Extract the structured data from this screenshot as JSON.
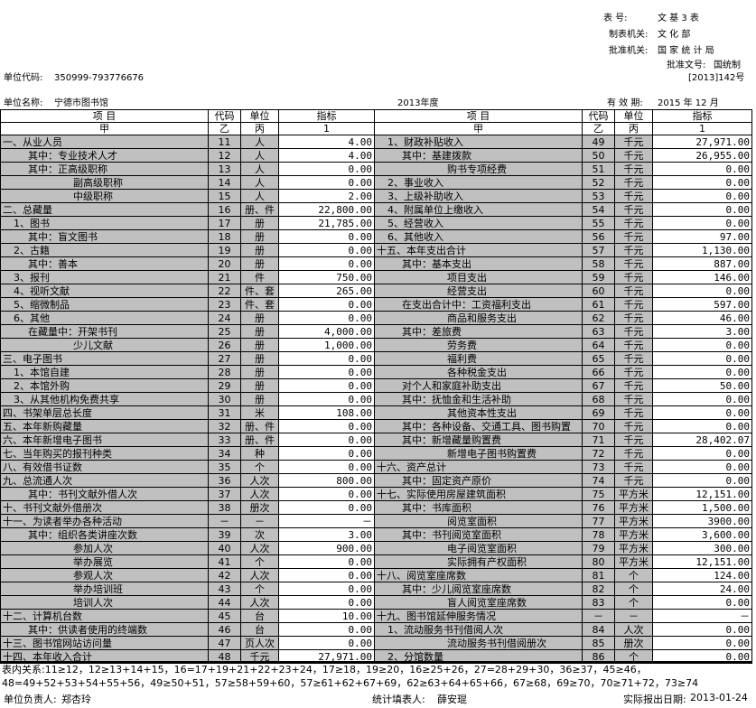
{
  "header": {
    "form_no_label": "表 号:",
    "form_no_value": "文 基 3 表",
    "org_label": "制表机关:",
    "org_value": "文 化 部",
    "approve_label": "批准机关:",
    "approve_value": "国 家 统 计 局",
    "approve_doc_label": "批准文号:",
    "approve_doc_value": "国统制",
    "approve_doc_no": "[2013]142号",
    "unit_code_label": "单位代码:",
    "unit_code": "350999-793776676",
    "unit_name_label": "单位名称:",
    "unit_name": "宁德市图书馆",
    "year": "2013年度",
    "valid_label": "有 效 期:",
    "valid_value": "2015 年 12 月"
  },
  "table": {
    "columns": [
      "项 目",
      "代码",
      "单位",
      "指标",
      "项 目",
      "代码",
      "单位",
      "指标"
    ],
    "subheads": [
      "甲",
      "乙",
      "丙",
      "1",
      "甲",
      "乙",
      "丙",
      "1"
    ],
    "rows": [
      [
        "一、从业人员",
        "11",
        "人",
        "4.00",
        "1、财政补贴收入",
        "49",
        "千元",
        "27,971.00"
      ],
      [
        "其中：专业技术人才",
        "12",
        "人",
        "4.00",
        "其中：基建拨款",
        "50",
        "千元",
        "26,955.00"
      ],
      [
        "其中：正高级职称",
        "13",
        "人",
        "0.00",
        "购书专项经费",
        "51",
        "千元",
        "0.00"
      ],
      [
        "副高级职称",
        "14",
        "人",
        "0.00",
        "2、事业收入",
        "52",
        "千元",
        "0.00"
      ],
      [
        "中级职称",
        "15",
        "人",
        "2.00",
        "3、上级补助收入",
        "53",
        "千元",
        "0.00"
      ],
      [
        "二、总藏量",
        "16",
        "册、件",
        "22,800.00",
        "4、附属单位上缴收入",
        "54",
        "千元",
        "0.00"
      ],
      [
        "1、图书",
        "17",
        "册",
        "21,785.00",
        "5、经营收入",
        "55",
        "千元",
        "0.00"
      ],
      [
        "其中：盲文图书",
        "18",
        "册",
        "0.00",
        "6、其他收入",
        "56",
        "千元",
        "97.00"
      ],
      [
        "2、古籍",
        "19",
        "册",
        "0.00",
        "十五、本年支出合计",
        "57",
        "千元",
        "1,130.00"
      ],
      [
        "其中：善本",
        "20",
        "册",
        "0.00",
        "其中：基本支出",
        "58",
        "千元",
        "887.00"
      ],
      [
        "3、报刊",
        "21",
        "件",
        "750.00",
        "项目支出",
        "59",
        "千元",
        "146.00"
      ],
      [
        "4、视听文献",
        "22",
        "件、套",
        "265.00",
        "经营支出",
        "60",
        "千元",
        "0.00"
      ],
      [
        "5、缩微制品",
        "23",
        "件、套",
        "0.00",
        "在支出合计中：工资福利支出",
        "61",
        "千元",
        "597.00"
      ],
      [
        "6、其他",
        "24",
        "册",
        "0.00",
        "商品和服务支出",
        "62",
        "千元",
        "46.00"
      ],
      [
        "在藏量中：开架书刊",
        "25",
        "册",
        "4,000.00",
        "其中：差旅费",
        "63",
        "千元",
        "3.00"
      ],
      [
        "少儿文献",
        "26",
        "册",
        "1,000.00",
        "劳务费",
        "64",
        "千元",
        "0.00"
      ],
      [
        "三、电子图书",
        "27",
        "册",
        "0.00",
        "福利费",
        "65",
        "千元",
        "0.00"
      ],
      [
        "1、本馆自建",
        "28",
        "册",
        "0.00",
        "各种税金支出",
        "66",
        "千元",
        "0.00"
      ],
      [
        "2、本馆外购",
        "29",
        "册",
        "0.00",
        "对个人和家庭补助支出",
        "67",
        "千元",
        "50.00"
      ],
      [
        "3、从其他机构免费共享",
        "30",
        "册",
        "0.00",
        "其中：抚恤金和生活补助",
        "68",
        "千元",
        "0.00"
      ],
      [
        "四、书架单层总长度",
        "31",
        "米",
        "108.00",
        "其他资本性支出",
        "69",
        "千元",
        "0.00"
      ],
      [
        "五、本年新购藏量",
        "32",
        "册、件",
        "0.00",
        "其中：各种设备、交通工具、图书购置",
        "70",
        "千元",
        "0.00"
      ],
      [
        "六、本年新增电子图书",
        "33",
        "册、件",
        "0.00",
        "其中：新增藏量购置费",
        "71",
        "千元",
        "28,402.07"
      ],
      [
        "七、当年购买的报刊种类",
        "34",
        "种",
        "0.00",
        "新增电子图书购置费",
        "72",
        "千元",
        "0.00"
      ],
      [
        "八、有效借书证数",
        "35",
        "个",
        "0.00",
        "十六、资产总计",
        "73",
        "千元",
        "0.00"
      ],
      [
        "九、总流通人次",
        "36",
        "人次",
        "800.00",
        "其中：固定资产原价",
        "74",
        "千元",
        "0.00"
      ],
      [
        "其中：书刊文献外借人次",
        "37",
        "人次",
        "0.00",
        "十七、实际使用房屋建筑面积",
        "75",
        "平方米",
        "12,151.00"
      ],
      [
        "十、书刊文献外借册次",
        "38",
        "册次",
        "0.00",
        "其中：书库面积",
        "76",
        "平方米",
        "1,500.00"
      ],
      [
        "十一、为读者举办各种活动",
        "－",
        "－",
        "－",
        "阅览室面积",
        "77",
        "平方米",
        "3900.00"
      ],
      [
        "其中：组织各类讲座次数",
        "39",
        "次",
        "3.00",
        "其中：书刊阅览室面积",
        "78",
        "平方米",
        "3,600.00"
      ],
      [
        "参加人次",
        "40",
        "人次",
        "900.00",
        "电子阅览室面积",
        "79",
        "平方米",
        "300.00"
      ],
      [
        "举办展览",
        "41",
        "个",
        "0.00",
        "实际拥有产权面积",
        "80",
        "平方米",
        "12,151.00"
      ],
      [
        "参观人次",
        "42",
        "人次",
        "0.00",
        "十八、阅览室座席数",
        "81",
        "个",
        "124.00"
      ],
      [
        "举办培训班",
        "43",
        "个",
        "0.00",
        "其中：少儿阅览室座席数",
        "82",
        "个",
        "24.00"
      ],
      [
        "培训人次",
        "44",
        "人次",
        "0.00",
        "盲人阅览室座席数",
        "83",
        "个",
        "0.00"
      ],
      [
        "十二、计算机台数",
        "45",
        "台",
        "10.00",
        "十九、图书馆延伸服务情况",
        "－",
        "－",
        "－"
      ],
      [
        "其中：供读者使用的终端数",
        "46",
        "台",
        "0.00",
        "1、流动服务书刊借阅人次",
        "84",
        "人次",
        "0.00"
      ],
      [
        "十三、图书馆网站访问量",
        "47",
        "页人次",
        "0.00",
        "流动服务书刊借阅册次",
        "85",
        "册次",
        "0.00"
      ],
      [
        "十四、本年收入合计",
        "48",
        "千元",
        "27,971.00",
        "2、分馆数量",
        "86",
        "个",
        "0.00"
      ]
    ]
  },
  "footer": {
    "relations_label": "表内关系:",
    "relations_line1": "11≥12，12≥13+14+15，16=17+19+21+22+23+24，17≥18，19≥20，16≥25+26，27=28+29+30，36≥37，45≥46，",
    "relations_line2": "48=49+52+53+54+55+56，49≥50+51，57≥58+59+60，57≥61+62+67+69，62≥63+64+65+66，67≥68，69≥70，70≥71+72，73≥74",
    "head_label": "单位负责人:",
    "head_name": "郑杏玲",
    "filler_label": "统计填表人:",
    "filler_name": "薛安琨",
    "date_label": "实际报出日期:",
    "date_value": "2013-01-24"
  }
}
